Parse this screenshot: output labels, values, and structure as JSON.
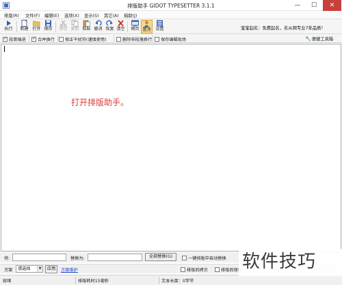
{
  "window": {
    "title": "排版助手 GIDOT TYPESETTER 3.1.1",
    "controls": {
      "minimize": "—",
      "maximize": "☐",
      "close": "✕"
    }
  },
  "menu": [
    "排版(R)",
    "文件(F)",
    "编辑(E)",
    "选项(X)",
    "显示(S)",
    "其它(A)",
    "捐助(J)"
  ],
  "toolbar": {
    "items": [
      {
        "label": "执行",
        "icon": "play-icon",
        "enabled": true
      },
      {
        "label": "新建",
        "icon": "new-file-icon",
        "enabled": true
      },
      {
        "label": "打开",
        "icon": "open-folder-icon",
        "enabled": true
      },
      {
        "label": "保存",
        "icon": "save-icon",
        "enabled": true
      },
      {
        "label": "剪切",
        "icon": "cut-icon",
        "enabled": false
      },
      {
        "label": "复制",
        "icon": "copy-icon",
        "enabled": false
      },
      {
        "label": "粘贴",
        "icon": "paste-icon",
        "enabled": true
      },
      {
        "label": "撤消",
        "icon": "undo-icon",
        "enabled": true
      },
      {
        "label": "恢复",
        "icon": "redo-icon",
        "enabled": true
      },
      {
        "label": "清空",
        "icon": "clear-icon",
        "enabled": true
      },
      {
        "label": "网页",
        "icon": "webpage-icon",
        "enabled": true
      },
      {
        "label": "置顶",
        "icon": "pin-top-icon",
        "enabled": true
      },
      {
        "label": "设置",
        "icon": "settings-icon",
        "enabled": true
      }
    ],
    "slogan": "宝宝起名：免费起名，名从网专业7年品质！"
  },
  "options": {
    "items": [
      {
        "label": "段首缩进",
        "checked": true
      },
      {
        "label": "合并换行",
        "checked": true
      },
      {
        "label": "修正干扰符(谨慎使用)",
        "checked": false
      },
      {
        "label": "删除非段落换行",
        "checked": false
      },
      {
        "label": "保存编辑现场",
        "checked": false
      }
    ],
    "quick_tools": "便捷工具箱"
  },
  "editor": {
    "message": "打开排版助手。",
    "message_color": "#d93a35"
  },
  "find": {
    "find_label": "将:",
    "find_value": "",
    "replace_label": "替换为:",
    "replace_value": "",
    "replace_all_button": "全部替换(G)",
    "auto_replace_label": "一键排版中自动替换",
    "auto_replace_checked": false
  },
  "scheme": {
    "label": "方案",
    "selected": "请选择",
    "apply_button": "应用",
    "maintain_link": "方案维护",
    "after_layout_copy": "排版后拷贝",
    "after_layout_save": "排版后保存"
  },
  "status": {
    "state": "就绪",
    "duration": "排版耗时15毫秒",
    "text_length": "文本长度：0字节"
  },
  "watermark": "软件技巧"
}
